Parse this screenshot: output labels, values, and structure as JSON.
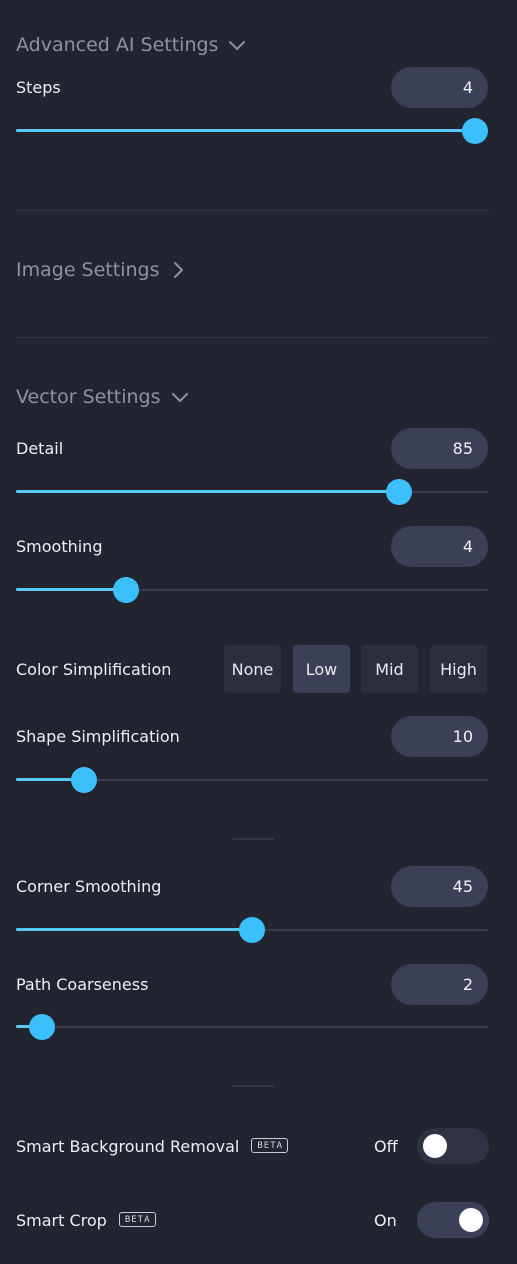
{
  "advanced_ai": {
    "title": "Advanced AI Settings",
    "expanded": true,
    "steps": {
      "label": "Steps",
      "value": "4",
      "fraction": 1.0
    }
  },
  "image_settings": {
    "title": "Image Settings",
    "expanded": false
  },
  "vector_settings": {
    "title": "Vector Settings",
    "expanded": true,
    "detail": {
      "label": "Detail",
      "value": "85",
      "fraction": 0.83
    },
    "smoothing": {
      "label": "Smoothing",
      "value": "4",
      "fraction": 0.217
    },
    "color_simplification": {
      "label": "Color Simplification",
      "options": [
        "None",
        "Low",
        "Mid",
        "High"
      ],
      "selected": "Low"
    },
    "shape_simplification": {
      "label": "Shape Simplification",
      "value": "10",
      "fraction": 0.123
    },
    "corner_smoothing": {
      "label": "Corner Smoothing",
      "value": "45",
      "fraction": 0.5
    },
    "path_coarseness": {
      "label": "Path Coarseness",
      "value": "2",
      "fraction": 0.03
    }
  },
  "smart_background_removal": {
    "label": "Smart Background Removal",
    "badge": "BETA",
    "state": "Off"
  },
  "smart_crop": {
    "label": "Smart Crop",
    "badge": "BETA",
    "state": "On"
  },
  "colors": {
    "accent": "#3cc0fb",
    "background": "#22242f",
    "pill": "#3b3f58"
  }
}
